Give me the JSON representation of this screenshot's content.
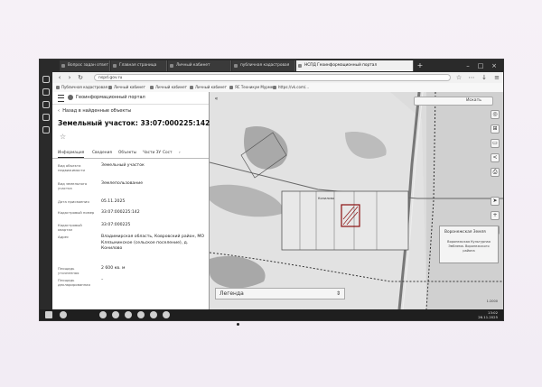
{
  "browser": {
    "tabs": [
      {
        "label": "Вопрос задан ответ"
      },
      {
        "label": "Главная страница"
      },
      {
        "label": "Личный кабинет"
      },
      {
        "label": "публичная кадастровая"
      },
      {
        "label": "НСПД Геоинформационный портал",
        "active": true
      }
    ],
    "address": "nspd.gov.ru",
    "bookmarks": [
      {
        "label": "Публичная кадастровая"
      },
      {
        "label": "Личный кабинет"
      },
      {
        "label": "Личный кабинет"
      },
      {
        "label": "Личный кабинет"
      },
      {
        "label": "ЯС Техникум Мурме"
      },
      {
        "label": "https://vk.com/..."
      }
    ]
  },
  "portal": {
    "title": "Геоинформационный портал",
    "back_label": "Назад в найденные объекты",
    "object_title": "Земельный участок: 33:07:000225:142",
    "tabs": [
      {
        "label": "Информация",
        "active": true
      },
      {
        "label": "Сведения"
      },
      {
        "label": "Объекты"
      },
      {
        "label": "Части ЗУ"
      },
      {
        "label": "Сост"
      }
    ],
    "fields": [
      {
        "key": "Вид объекта недвижимости",
        "value": "Земельный участок"
      },
      {
        "key": "Вид земельного участка",
        "value": "Землепользование"
      },
      {
        "key": "Дата присвоения",
        "value": "05.11.2025"
      },
      {
        "key": "Кадастровый номер",
        "value": "33:07:000225:142"
      },
      {
        "key": "Кадастровый квартал",
        "value": "33:07:000225"
      },
      {
        "key": "Адрес",
        "value": "Владимирская область, Ковровский район, МО Клязьминское (сельское поселение), д. Конилово"
      },
      {
        "key": "Площадь уточненная",
        "value": "2 600 кв. м"
      },
      {
        "key": "Площадь декларированная",
        "value": "–"
      }
    ]
  },
  "map": {
    "search_placeholder": "Искать",
    "legend_label": "Легенда",
    "parcel_label": "Конилово",
    "popup_title": "Воронежская Земля",
    "popup_body": "Воронежская Культурная Эмблема. Воронежского района",
    "scale": "1:2000"
  },
  "taskbar": {
    "time": "13:02",
    "date": "26.11.2025"
  }
}
